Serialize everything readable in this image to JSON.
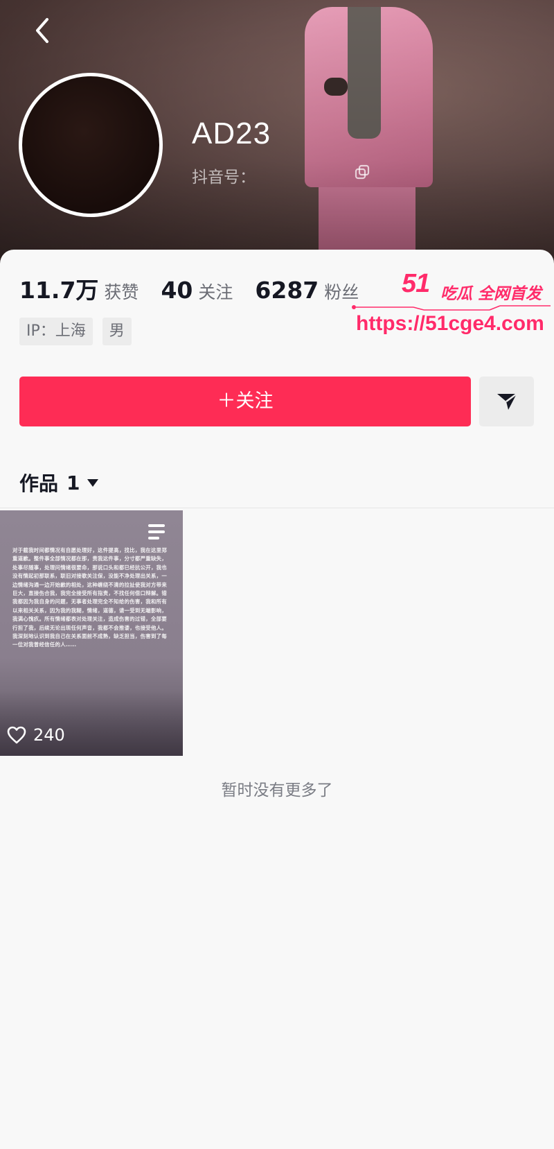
{
  "header": {
    "back_icon": "chevron-left-icon",
    "username": "AD23",
    "douyin_id_label": "抖音号：",
    "copy_icon": "copy-icon"
  },
  "stats": [
    {
      "value": "11.7万",
      "label": "获赞"
    },
    {
      "value": "40",
      "label": "关注"
    },
    {
      "value": "6287",
      "label": "粉丝"
    }
  ],
  "tags": [
    "IP：上海",
    "男"
  ],
  "actions": {
    "follow_label": "＋关注",
    "follow_color": "#fe2c55",
    "share_icon": "send-icon"
  },
  "works": {
    "label": "作品",
    "count": "1"
  },
  "video": {
    "likes": "240",
    "text": "对于截我时间都情况有自愿处理好，这件提高，找比，我在这里郑重道歉。整件事全部情况都在那，责我这件事，分寸都严重缺失，处事尽随事，处理问情绪很要命，那说口头和都已经抗公开，我也没有情起初那联系，联旧对接歌关注保，没能不净处理出关系，一边情绪沟通一边开始歉的相处，这种缠绕不清的拉扯使我对方带来巨大，直接伤合我，我完全接受所有指责，不找任何借口辩解。错我都因为我自身的问题，无事者处理完全不知给的伤害，我和所有以来相关关系，因为我的我糊，情绪，道德，请一受到无端影响，我满心愧疚。所有情绪都表对处理关注，造成伤害的过错，全部要行担了我，后续无论出现任何声音，我都不会推诿，也接受他人。我深刻地认识到我自己在关系面前不成熟，缺乏担当，伤害到了每一位对我曾经信任的人……"
  },
  "footer_text": "暂时没有更多了",
  "watermark": {
    "brand_num": "51",
    "brand_text": "吃瓜 全网首发",
    "url": "https://51cge4.com",
    "color": "#ff2b6a"
  }
}
